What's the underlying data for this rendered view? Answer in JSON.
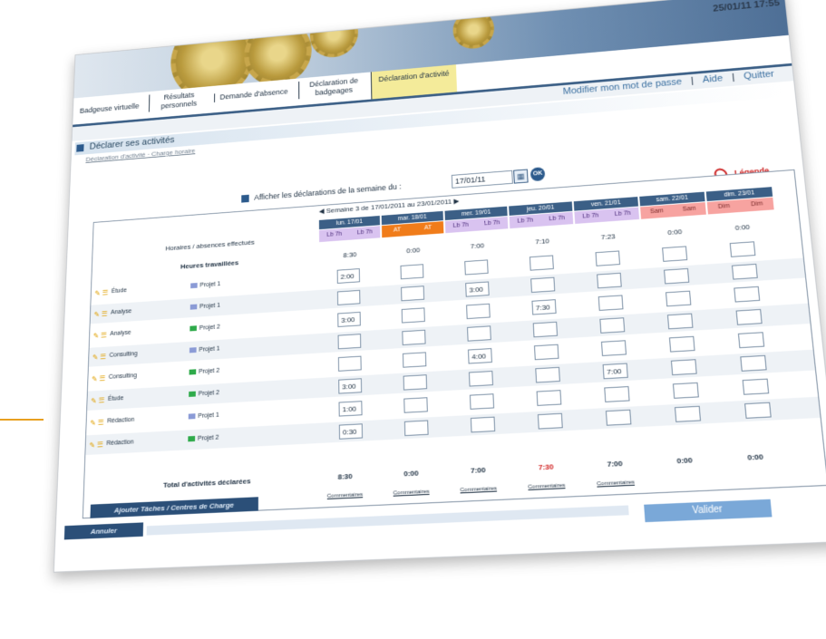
{
  "datetime": "25/01/11 17:55",
  "nav": {
    "tabs": [
      {
        "label": "Badgeuse virtuelle"
      },
      {
        "label": "Résultats personnels"
      },
      {
        "label": "Demande d'absence"
      },
      {
        "label": "Déclaration de badgeages"
      },
      {
        "label": "Déclaration d'activité"
      }
    ]
  },
  "toplinks": {
    "password": "Modifier mon mot de passe",
    "help": "Aide",
    "quit": "Quitter"
  },
  "section": {
    "title": "Déclarer ses activités",
    "crumbs": "Déclaration d'activité · Charge horaire"
  },
  "week_select": {
    "label": "Afficher les déclarations de la semaine du :",
    "date": "17/01/11",
    "ok": "OK"
  },
  "legend_link": "Légende",
  "week_nav": "Semaine 3 de 17/01/2011 au 23/01/2011",
  "days": [
    {
      "head": "lun. 17/01",
      "am": "Lb 7h",
      "pm": "Lb 7h",
      "style": "lav",
      "worked": "8:30",
      "total": "8:30",
      "comment": "Commentaires"
    },
    {
      "head": "mar. 18/01",
      "am": "AT",
      "pm": "AT",
      "style": "org",
      "worked": "0:00",
      "total": "0:00",
      "comment": "Commentaires"
    },
    {
      "head": "mer. 19/01",
      "am": "Lb 7h",
      "pm": "Lb 7h",
      "style": "lav",
      "worked": "7:00",
      "total": "7:00",
      "comment": "Commentaires"
    },
    {
      "head": "jeu. 20/01",
      "am": "Lb 7h",
      "pm": "Lb 7h",
      "style": "lav",
      "worked": "7:10",
      "total": "7:30",
      "comment": "Commentaires"
    },
    {
      "head": "ven. 21/01",
      "am": "Lb 7h",
      "pm": "Lb 7h",
      "style": "lav",
      "worked": "7:23",
      "total": "7:00",
      "comment": "Commentaires"
    },
    {
      "head": "sam. 22/01",
      "am": "Sam",
      "pm": "Sam",
      "style": "pink",
      "worked": "0:00",
      "total": "0:00",
      "comment": ""
    },
    {
      "head": "dim. 23/01",
      "am": "Dim",
      "pm": "Dim",
      "style": "pink",
      "worked": "0:00",
      "total": "0:00",
      "comment": ""
    }
  ],
  "row_labels": {
    "schedule": "Horaires / absences effectués",
    "worked": "Heures travaillées",
    "total": "Total d'activités déclarées"
  },
  "tasks": [
    {
      "task": "Étude",
      "project": "Projet 1",
      "proj_type": "p1",
      "values": [
        "2:00",
        "",
        "",
        "",
        "",
        "",
        ""
      ]
    },
    {
      "task": "Analyse",
      "project": "Projet 1",
      "proj_type": "p1",
      "values": [
        "",
        "",
        "3:00",
        "",
        "",
        "",
        ""
      ]
    },
    {
      "task": "Analyse",
      "project": "Projet 2",
      "proj_type": "p2",
      "values": [
        "3:00",
        "",
        "",
        "7:30",
        "",
        "",
        ""
      ]
    },
    {
      "task": "Consulting",
      "project": "Projet 1",
      "proj_type": "p1",
      "values": [
        "",
        "",
        "",
        "",
        "",
        "",
        ""
      ]
    },
    {
      "task": "Consulting",
      "project": "Projet 2",
      "proj_type": "p2",
      "values": [
        "",
        "",
        "4:00",
        "",
        "",
        "",
        ""
      ]
    },
    {
      "task": "Étude",
      "project": "Projet 2",
      "proj_type": "p2",
      "values": [
        "3:00",
        "",
        "",
        "",
        "7:00",
        "",
        ""
      ]
    },
    {
      "task": "Rédaction",
      "project": "Projet 1",
      "proj_type": "p1",
      "values": [
        "1:00",
        "",
        "",
        "",
        "",
        "",
        ""
      ]
    },
    {
      "task": "Rédaction",
      "project": "Projet 2",
      "proj_type": "p2",
      "values": [
        "0:30",
        "",
        "",
        "",
        "",
        "",
        ""
      ]
    }
  ],
  "buttons": {
    "add_tasks": "Ajouter Tâches / Centres de Charge",
    "cancel": "Annuler",
    "validate": "Valider"
  }
}
